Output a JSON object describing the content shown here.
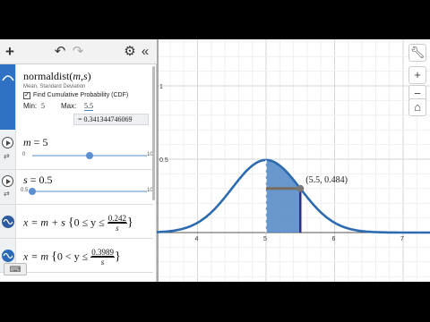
{
  "toolbar": {
    "add_icon": "plus-icon",
    "undo_icon": "undo-icon",
    "redo_icon": "redo-icon",
    "settings_icon": "gear-icon",
    "collapse_icon": "chevron-left-icon"
  },
  "dist": {
    "name": "normaldist",
    "args": "m,s",
    "subtitle": "Mean, Standard Deviation",
    "cdf_label": "Find Cumulative Probability (CDF)",
    "cdf_checked": true,
    "min_label": "Min:",
    "min_value": "5",
    "max_label": "Max:",
    "max_value": "5.5",
    "result": "= 0.341344746069"
  },
  "sliders": [
    {
      "var": "m",
      "value": "5",
      "lo": "0",
      "hi": "10",
      "frac": 0.5
    },
    {
      "var": "s",
      "value": "0.5",
      "lo": "0.5",
      "hi": "10",
      "frac": 0.0
    }
  ],
  "expr4": {
    "lhs": "x = m + s",
    "cond_lo": "0 ≤ y ≤",
    "num": "0.242",
    "den": "s"
  },
  "expr5": {
    "lhs": "x = m",
    "cond_lo": "0 < y ≤",
    "num": "0.3989",
    "den": "s"
  },
  "graph": {
    "x_ticks": [
      "4",
      "5",
      "6",
      "7"
    ],
    "y_ticks": [
      "1",
      "0.5"
    ],
    "point_label": "(5.5, 0.484)",
    "curve_color": "#2d6bb0",
    "fill_color": "#4f86c6",
    "bar_color": "#2d2d9a",
    "seg_color": "#7a6a5a"
  },
  "graph_buttons": {
    "wrench": "wrench-icon",
    "zoom_in": "+",
    "zoom_out": "−",
    "home": "home-icon"
  },
  "keyboard_icon": "keyboard-icon"
}
